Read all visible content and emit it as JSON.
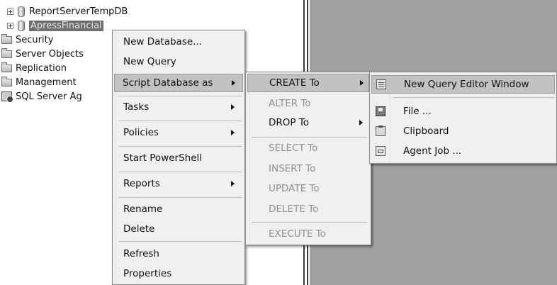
{
  "tree": [
    {
      "label": "ReportServerTempDB",
      "icon": "database-icon",
      "expander": true
    },
    {
      "label": "ApressFinancial",
      "icon": "database-icon",
      "expander": true,
      "selected": true
    },
    {
      "label": "Security",
      "icon": "folder-icon"
    },
    {
      "label": "Server Objects",
      "icon": "folder-icon"
    },
    {
      "label": "Replication",
      "icon": "folder-icon"
    },
    {
      "label": "Management",
      "icon": "folder-icon"
    },
    {
      "label": "SQL Server Ag",
      "icon": "sql-agent-icon"
    }
  ],
  "context_menu": {
    "items": [
      {
        "label": "New Database..."
      },
      {
        "label": "New Query"
      },
      {
        "label": "Script Database as",
        "submenu": true,
        "highlighted": true
      },
      {
        "label": "Tasks",
        "submenu": true
      },
      {
        "label": "Policies",
        "submenu": true
      },
      {
        "label": "Start PowerShell"
      },
      {
        "label": "Reports",
        "submenu": true
      },
      {
        "label": "Rename"
      },
      {
        "label": "Delete"
      },
      {
        "label": "Refresh"
      },
      {
        "label": "Properties"
      }
    ]
  },
  "script_menu": {
    "items": [
      {
        "label": "CREATE To",
        "submenu": true,
        "highlighted": true
      },
      {
        "label": "ALTER To",
        "disabled": true
      },
      {
        "label": "DROP To",
        "submenu": true
      },
      {
        "label": "SELECT To",
        "disabled": true
      },
      {
        "label": "INSERT To",
        "disabled": true
      },
      {
        "label": "UPDATE To",
        "disabled": true
      },
      {
        "label": "DELETE To",
        "disabled": true
      },
      {
        "label": "EXECUTE To",
        "disabled": true
      }
    ]
  },
  "create_menu": {
    "items": [
      {
        "label": "New Query Editor Window",
        "icon": "query-window-icon",
        "highlighted": true
      },
      {
        "label": "File ...",
        "icon": "save-file-icon"
      },
      {
        "label": "Clipboard",
        "icon": "clipboard-icon"
      },
      {
        "label": "Agent Job ...",
        "icon": "agent-job-icon"
      }
    ]
  },
  "colors": {
    "right_pane": "#a0a0a0",
    "menu_bg": "#f0f0f0",
    "highlight": "#c2c2c2",
    "disabled_text": "#8f8f8f",
    "selected_node": "#6e6e6e"
  }
}
